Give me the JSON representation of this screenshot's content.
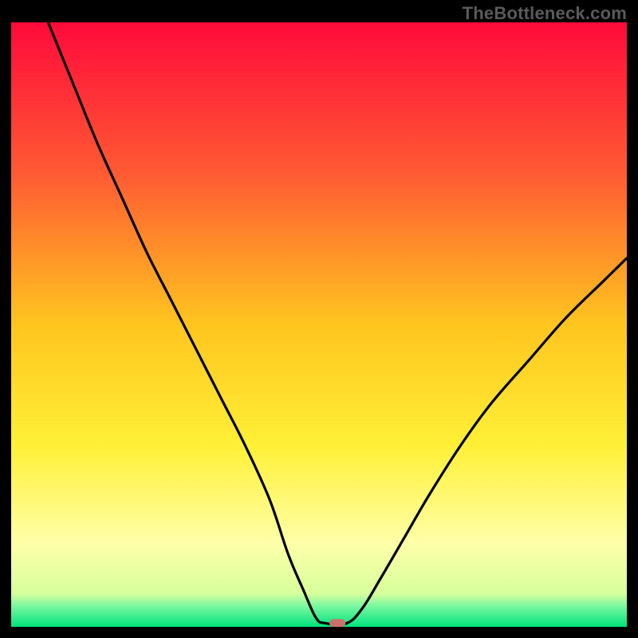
{
  "watermark": "TheBottleneck.com",
  "chart_data": {
    "type": "line",
    "title": "",
    "xlabel": "",
    "ylabel": "",
    "xlim": [
      0,
      100
    ],
    "ylim": [
      0,
      100
    ],
    "grid": false,
    "legend": false,
    "background": {
      "type": "vertical-gradient",
      "stops": [
        {
          "pos": 0.0,
          "color": "#ff0a3b"
        },
        {
          "pos": 0.25,
          "color": "#ff5a33"
        },
        {
          "pos": 0.5,
          "color": "#ffc51f"
        },
        {
          "pos": 0.7,
          "color": "#fff036"
        },
        {
          "pos": 0.86,
          "color": "#ffffa8"
        },
        {
          "pos": 0.945,
          "color": "#d7ff9c"
        },
        {
          "pos": 0.965,
          "color": "#7cf8a0"
        },
        {
          "pos": 1.0,
          "color": "#00e37d"
        }
      ]
    },
    "series": [
      {
        "name": "curve-left",
        "x": [
          6,
          10,
          14,
          18,
          22,
          26,
          30,
          34,
          38,
          42,
          45,
          47.5,
          49.5,
          51
        ],
        "y": [
          100,
          90,
          80,
          71,
          62,
          54,
          46,
          38,
          30,
          21,
          12,
          6,
          1.5,
          0.6
        ]
      },
      {
        "name": "flat-min",
        "x": [
          51,
          54.5
        ],
        "y": [
          0.6,
          0.6
        ]
      },
      {
        "name": "curve-right",
        "x": [
          54.5,
          57,
          60,
          64,
          68,
          73,
          78,
          84,
          90,
          96,
          100
        ],
        "y": [
          0.6,
          3,
          8,
          15,
          22,
          30,
          37,
          44,
          51,
          57,
          61
        ]
      }
    ],
    "marker": {
      "name": "min-pill",
      "x": 53,
      "y": 0.6,
      "width_pct": 2.6,
      "height_pct": 1.4,
      "color": "#c9716b"
    }
  }
}
